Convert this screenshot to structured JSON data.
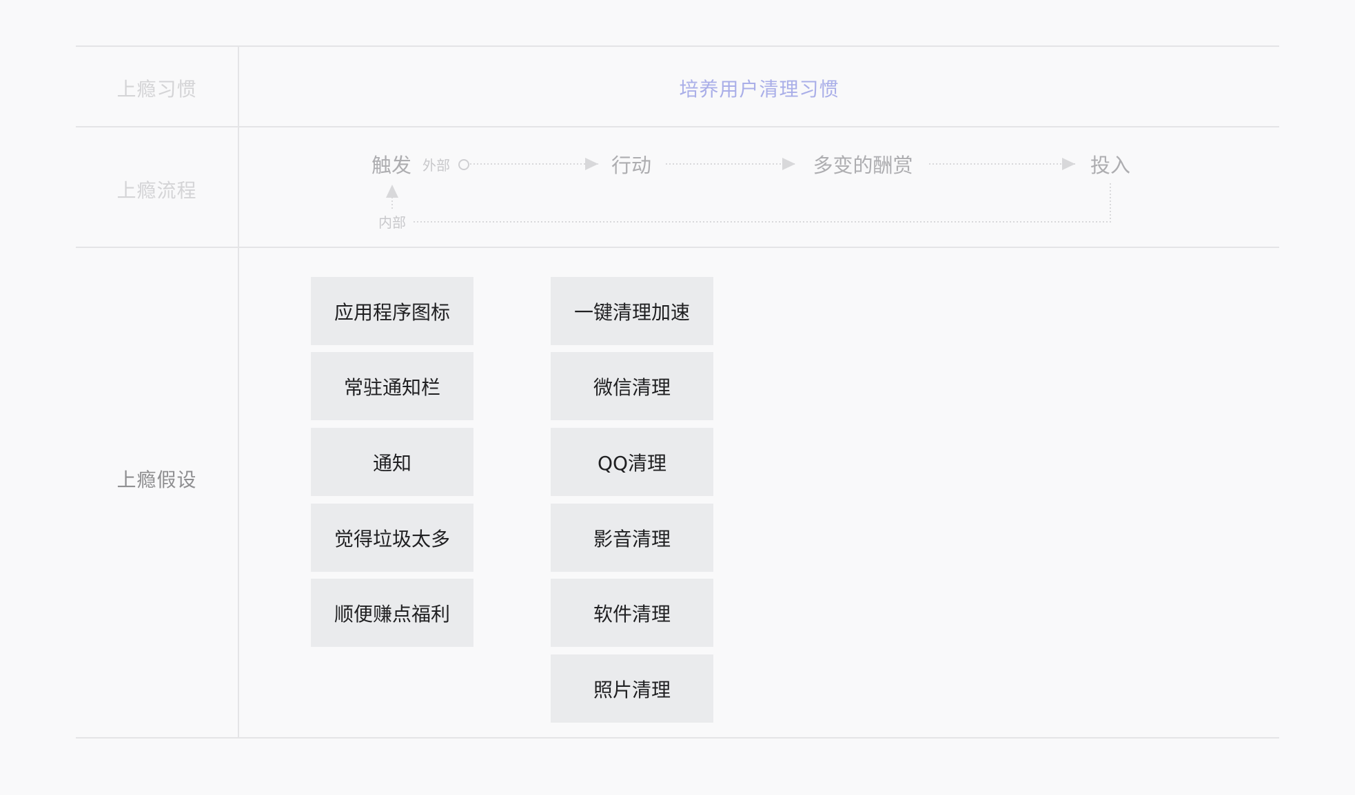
{
  "rows": {
    "habit": {
      "label": "上瘾习惯",
      "value": "培养用户清理习惯"
    },
    "flow": {
      "label": "上瘾流程",
      "trigger": "触发",
      "external": "外部",
      "internal": "内部",
      "action": "行动",
      "reward": "多变的酬赏",
      "investment": "投入"
    },
    "hypothesis": {
      "label": "上瘾假设",
      "triggers": [
        "应用程序图标",
        "常驻通知栏",
        "通知",
        "觉得垃圾太多",
        "顺便赚点福利"
      ],
      "actions": [
        "一键清理加速",
        "微信清理",
        "QQ清理",
        "影音清理",
        "软件清理",
        "照片清理"
      ]
    }
  },
  "colors": {
    "accent": "#a9aee8",
    "grid_line": "#e4e4e6",
    "box_bg": "#eaebed",
    "flow_text": "#adadb0"
  }
}
